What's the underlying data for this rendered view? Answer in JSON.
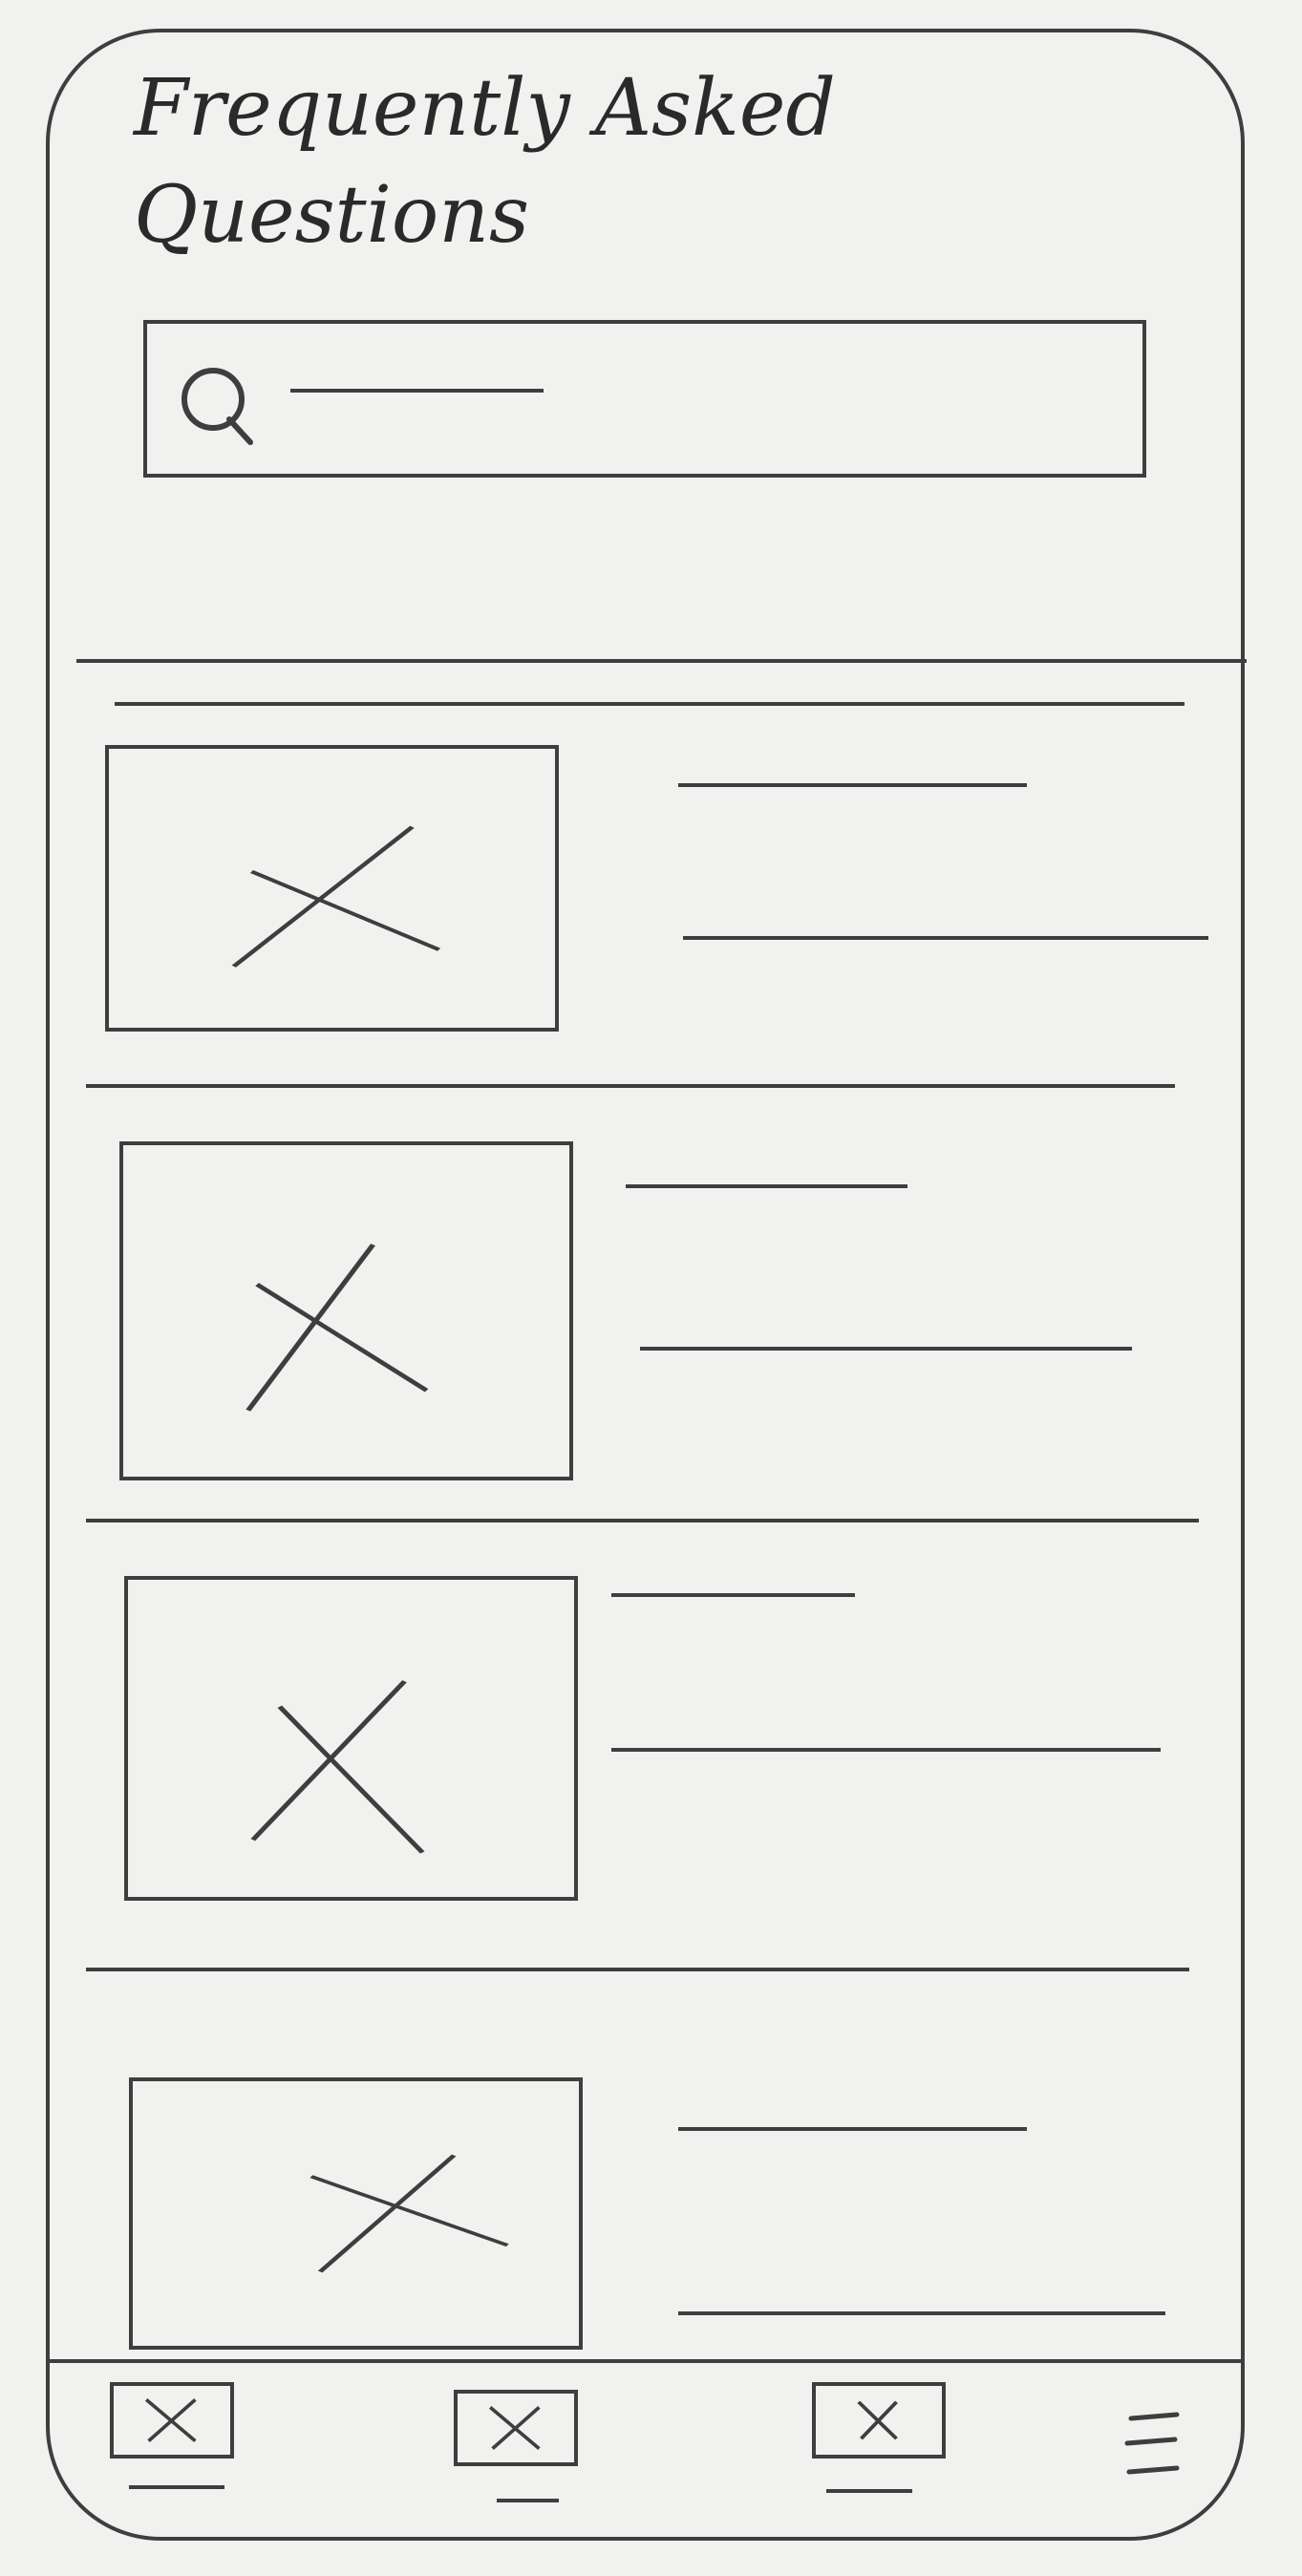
{
  "header": {
    "title_line1": "Frequently Asked",
    "title_line2": "Questions"
  },
  "search": {
    "placeholder": ""
  },
  "icons": {
    "search": "search-icon",
    "thumbnail": "image-placeholder-icon",
    "nav": "image-placeholder-icon",
    "menu": "hamburger-menu-icon"
  },
  "colors": {
    "ink": "#3e3e3e",
    "paper": "#f1f1ef"
  }
}
